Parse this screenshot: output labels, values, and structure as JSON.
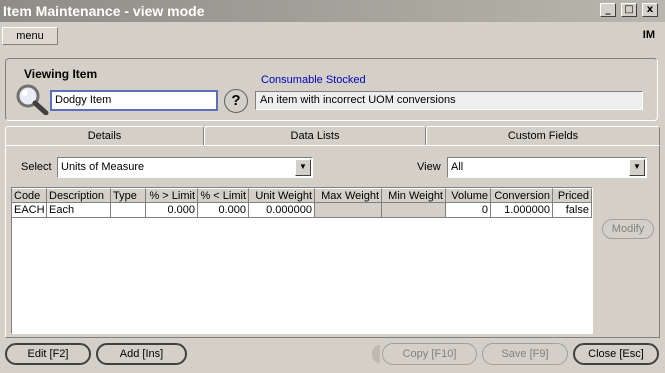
{
  "window": {
    "title": "Item Maintenance - view mode"
  },
  "window_controls": {
    "minimize": "_",
    "maximize": "□",
    "close": "x"
  },
  "menu": {
    "label": "menu",
    "app_code": "IM"
  },
  "header": {
    "viewing_label": "Viewing Item",
    "item_name": "Dodgy Item",
    "help_glyph": "?",
    "item_type": "Consumable Stocked",
    "description": "An item with incorrect UOM conversions"
  },
  "tabs": [
    {
      "label": "Details"
    },
    {
      "label": "Data Lists"
    },
    {
      "label": "Custom Fields"
    }
  ],
  "filters": {
    "select_label": "Select",
    "select_value": "Units of Measure",
    "view_label": "View",
    "view_value": "All"
  },
  "grid": {
    "columns": [
      "Code",
      "Description",
      "Type",
      "% > Limit",
      "% < Limit",
      "Unit Weight",
      "Max Weight",
      "Min Weight",
      "Volume",
      "Conversion",
      "Priced"
    ],
    "rows": [
      [
        "EACH",
        "Each",
        "",
        "0.000",
        "0.000",
        "0.000000",
        "",
        "",
        "0",
        "1.000000",
        "false"
      ]
    ]
  },
  "side_actions": {
    "modify": "Modify"
  },
  "buttons": {
    "edit": "Edit   [F2]",
    "add": "Add    [Ins]",
    "copy": "Copy  [F10]",
    "save": "Save   [F9]",
    "close": "Close  [Esc]"
  }
}
